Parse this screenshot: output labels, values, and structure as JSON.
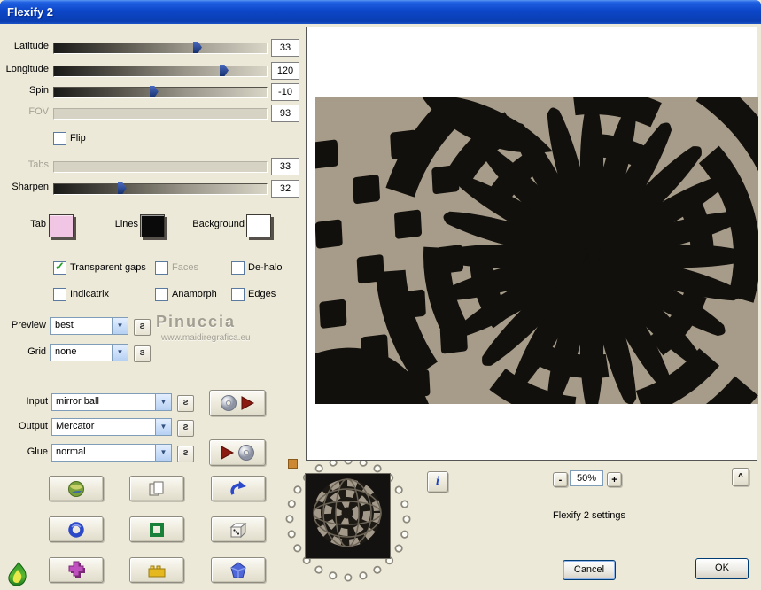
{
  "window": {
    "title": "Flexify 2"
  },
  "sliders": {
    "latitude": {
      "label": "Latitude",
      "value": "33"
    },
    "longitude": {
      "label": "Longitude",
      "value": "120"
    },
    "spin": {
      "label": "Spin",
      "value": "-10"
    },
    "fov": {
      "label": "FOV",
      "value": "93"
    },
    "tabs": {
      "label": "Tabs",
      "value": "33"
    },
    "sharpen": {
      "label": "Sharpen",
      "value": "32"
    }
  },
  "flip": {
    "label": "Flip"
  },
  "swatches": {
    "tab": {
      "label": "Tab",
      "color": "#f0c6e4"
    },
    "lines": {
      "label": "Lines",
      "color": "#0a0a0a"
    },
    "background": {
      "label": "Background",
      "color": "#ffffff"
    }
  },
  "checkboxes": {
    "transparent_gaps": {
      "label": "Transparent gaps",
      "checked": true
    },
    "faces": {
      "label": "Faces"
    },
    "dehalo": {
      "label": "De-halo"
    },
    "indicatrix": {
      "label": "Indicatrix"
    },
    "anamorph": {
      "label": "Anamorph"
    },
    "edges": {
      "label": "Edges"
    }
  },
  "selects": {
    "preview": {
      "label": "Preview",
      "value": "best"
    },
    "grid": {
      "label": "Grid",
      "value": "none"
    },
    "input": {
      "label": "Input",
      "value": "mirror ball"
    },
    "output": {
      "label": "Output",
      "value": "Mercator"
    },
    "glue": {
      "label": "Glue",
      "value": "normal"
    }
  },
  "watermark": {
    "title": "Pinuccia",
    "url": "www.maidiregrafica.eu"
  },
  "zoom": {
    "minus": "-",
    "level": "50%",
    "plus": "+",
    "caret": "^"
  },
  "status": {
    "text": "Flexify 2 settings"
  },
  "actions": {
    "cancel": "Cancel",
    "ok": "OK"
  },
  "glyphs": {
    "s_button": "ƨ",
    "dropdown_arrow": "▼",
    "info": "i",
    "check": "✓"
  },
  "colors": {
    "accent_titlebar": "#0c46c8",
    "pattern_tan": "#a79c8a",
    "pattern_black": "#12100c"
  }
}
